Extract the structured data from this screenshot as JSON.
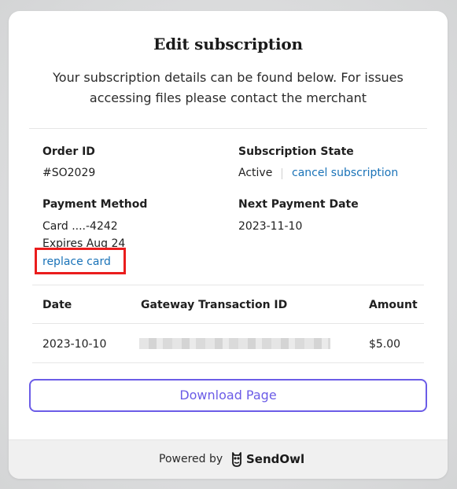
{
  "modal": {
    "title": "Edit subscription",
    "subtitle": "Your subscription details can be found below. For issues accessing files please contact the merchant"
  },
  "details": {
    "order_id_label": "Order ID",
    "order_id_value": "#SO2029",
    "state_label": "Subscription State",
    "state_value": "Active",
    "cancel_link": "cancel subscription",
    "payment_label": "Payment Method",
    "card_value": "Card ....-4242",
    "expires_value": "Expires Aug 24",
    "replace_link": "replace card",
    "next_payment_label": "Next Payment Date",
    "next_payment_value": "2023-11-10"
  },
  "table": {
    "headers": [
      "Date",
      "Gateway Transaction ID",
      "Amount"
    ],
    "rows": [
      {
        "date": "2023-10-10",
        "transaction_id": "",
        "amount": "$5.00"
      }
    ]
  },
  "download_label": "Download Page",
  "footer": {
    "powered_by": "Powered by",
    "brand": "SendOwl"
  },
  "colors": {
    "link": "#1a73b8",
    "accent": "#6b5ce7",
    "highlight": "#ea1d1d"
  }
}
